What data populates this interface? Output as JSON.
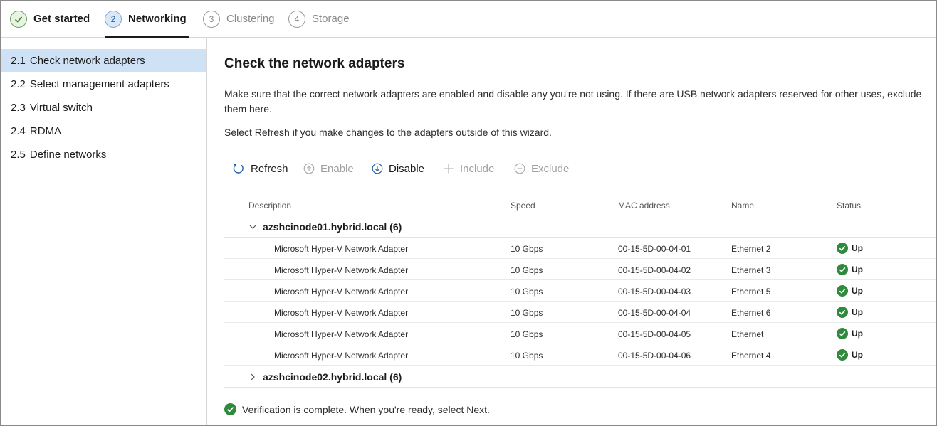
{
  "steps": [
    {
      "number": "",
      "label": "Get started",
      "state": "done"
    },
    {
      "number": "2",
      "label": "Networking",
      "state": "active"
    },
    {
      "number": "3",
      "label": "Clustering",
      "state": "pending"
    },
    {
      "number": "4",
      "label": "Storage",
      "state": "pending"
    }
  ],
  "sidebar": {
    "items": [
      {
        "num": "2.1",
        "label": "Check network adapters",
        "selected": true
      },
      {
        "num": "2.2",
        "label": "Select management adapters",
        "selected": false
      },
      {
        "num": "2.3",
        "label": "Virtual switch",
        "selected": false
      },
      {
        "num": "2.4",
        "label": "RDMA",
        "selected": false
      },
      {
        "num": "2.5",
        "label": "Define networks",
        "selected": false
      }
    ]
  },
  "main": {
    "title": "Check the network adapters",
    "description": "Make sure that the correct network adapters are enabled and disable any you're not using. If there are USB network adapters reserved for other uses, exclude them here.",
    "refresh_hint": "Select Refresh if you make changes to the adapters outside of this wizard."
  },
  "toolbar": {
    "refresh": "Refresh",
    "enable": "Enable",
    "disable": "Disable",
    "include": "Include",
    "exclude": "Exclude"
  },
  "table": {
    "columns": {
      "description": "Description",
      "speed": "Speed",
      "mac": "MAC address",
      "name": "Name",
      "status": "Status"
    },
    "groups": [
      {
        "label": "azshcinode01.hybrid.local (6)",
        "expanded": true,
        "rows": [
          {
            "description": "Microsoft Hyper-V Network Adapter",
            "speed": "10 Gbps",
            "mac": "00-15-5D-00-04-01",
            "name": "Ethernet 2",
            "status": "Up"
          },
          {
            "description": "Microsoft Hyper-V Network Adapter",
            "speed": "10 Gbps",
            "mac": "00-15-5D-00-04-02",
            "name": "Ethernet 3",
            "status": "Up"
          },
          {
            "description": "Microsoft Hyper-V Network Adapter",
            "speed": "10 Gbps",
            "mac": "00-15-5D-00-04-03",
            "name": "Ethernet 5",
            "status": "Up"
          },
          {
            "description": "Microsoft Hyper-V Network Adapter",
            "speed": "10 Gbps",
            "mac": "00-15-5D-00-04-04",
            "name": "Ethernet 6",
            "status": "Up"
          },
          {
            "description": "Microsoft Hyper-V Network Adapter",
            "speed": "10 Gbps",
            "mac": "00-15-5D-00-04-05",
            "name": "Ethernet",
            "status": "Up"
          },
          {
            "description": "Microsoft Hyper-V Network Adapter",
            "speed": "10 Gbps",
            "mac": "00-15-5D-00-04-06",
            "name": "Ethernet 4",
            "status": "Up"
          }
        ]
      },
      {
        "label": "azshcinode02.hybrid.local (6)",
        "expanded": false,
        "rows": []
      }
    ]
  },
  "footer": {
    "message": "Verification is complete. When you're ready, select Next."
  },
  "icons": {
    "check": "check-icon",
    "refresh": "refresh-icon",
    "enable": "arrow-up-circle-icon",
    "disable": "arrow-down-circle-icon",
    "include": "plus-icon",
    "exclude": "minus-circle-icon",
    "status_up": "status-up-icon",
    "expand": "chevron-down-icon",
    "collapse": "chevron-right-icon"
  },
  "colors": {
    "accent": "#1f5fa8",
    "success": "#2e8b3e",
    "selected_bg": "#cfe2f5",
    "disabled_text": "#a0a0a0"
  }
}
